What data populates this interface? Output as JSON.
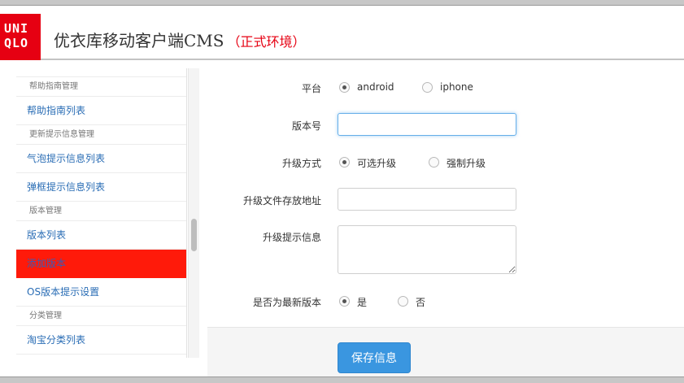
{
  "header": {
    "logo_lines": [
      "UNI",
      "QLO"
    ],
    "title": "优衣库移动客户端CMS",
    "env": "（正式环境）"
  },
  "sidebar": {
    "groups": [
      {
        "label": "帮助指南管理",
        "items": [
          "帮助指南列表"
        ]
      },
      {
        "label": "更新提示信息管理",
        "items": [
          "气泡提示信息列表",
          "弹框提示信息列表"
        ]
      },
      {
        "label": "版本管理",
        "items": [
          "版本列表",
          "添加版本",
          "OS版本提示设置"
        ]
      },
      {
        "label": "分类管理",
        "items": [
          "淘宝分类列表"
        ]
      }
    ],
    "active_item": "添加版本"
  },
  "form": {
    "platform": {
      "label": "平台",
      "options": [
        "android",
        "iphone"
      ],
      "selected": "android"
    },
    "version": {
      "label": "版本号",
      "value": "",
      "placeholder": ""
    },
    "upgrade_mode": {
      "label": "升级方式",
      "options": [
        "可选升级",
        "强制升级"
      ],
      "selected": "可选升级"
    },
    "file_url": {
      "label": "升级文件存放地址",
      "value": ""
    },
    "upgrade_message": {
      "label": "升级提示信息",
      "value": ""
    },
    "is_latest": {
      "label": "是否为最新版本",
      "options": [
        "是",
        "否"
      ],
      "selected": "是"
    },
    "save_label": "保存信息"
  },
  "colors": {
    "brand_red": "#e60012",
    "active_item_bg": "#ff1a0a",
    "link_blue": "#2a6db5",
    "button_blue": "#3a96e0"
  }
}
